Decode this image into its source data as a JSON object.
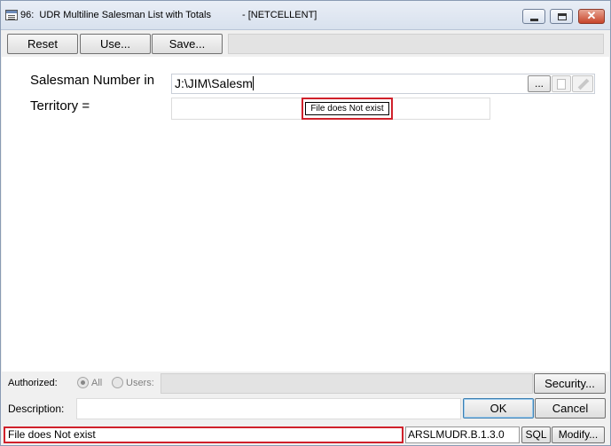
{
  "window": {
    "title": "96:  UDR Multiline Salesman List with Totals",
    "title_suffix": "- [NETCELLENT]",
    "close_glyph": "✕"
  },
  "toolbar": {
    "reset_label": "Reset",
    "use_label": "Use...",
    "save_label": "Save..."
  },
  "form": {
    "salesman_label": "Salesman Number in",
    "salesman_value": "J:\\JIM\\Salesm",
    "browse_label": "...",
    "territory_label": "Territory =",
    "tooltip_text": "File does Not exist"
  },
  "footer": {
    "authorized_label": "Authorized:",
    "all_label": "All",
    "users_label": "Users:",
    "security_label": "Security...",
    "description_label": "Description:",
    "ok_label": "OK",
    "cancel_label": "Cancel"
  },
  "status": {
    "message": "File does Not exist",
    "code": "ARSLMUDR.B.1.3.0",
    "sql_label": "SQL",
    "modify_label": "Modify..."
  }
}
